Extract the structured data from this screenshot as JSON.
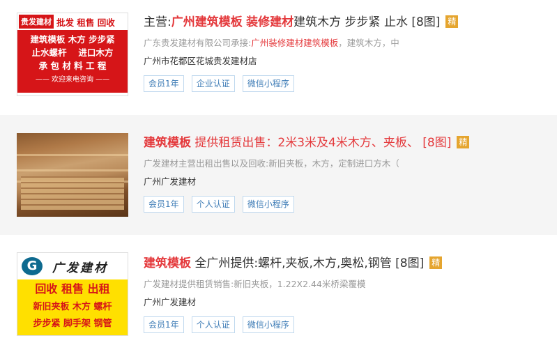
{
  "items": [
    {
      "title_prefix": "主营:",
      "title_kw1": "广州建筑模板",
      "title_sep": " ",
      "title_kw2": "装修建材",
      "title_rest": "建筑木方 步步紧 止水 [8图]",
      "badge": "精",
      "desc_prefix": "广东贵发建材有限公司承接:",
      "desc_red": "广州装修建材建筑模板",
      "desc_rest": "，建筑木方，中",
      "address": "广州市花都区花城贵发建材店",
      "tags": [
        "会员1年",
        "企业认证",
        "微信小程序"
      ],
      "thumb": {
        "logo": "贵发建材",
        "top_text": "批发 租售 回收",
        "lines": [
          "建筑模板 木方 步步紧",
          "止水螺杆　 进口木方",
          "承 包 材 料 工 程"
        ],
        "footer": "—— 欢迎来电咨询 ——"
      }
    },
    {
      "title_kw": "建筑模板",
      "title_rest": " 提供租赁出售：2米3米及4米木方、夹板、 [8图]",
      "badge": "精",
      "desc": "广发建材主营出租出售以及回收:新旧夹板，木方，定制进口方木（",
      "address": "广州广发建材",
      "tags": [
        "会员1年",
        "个人认证",
        "微信小程序"
      ]
    },
    {
      "title_kw": "建筑模板",
      "title_rest": " 全广州提供:螺杆,夹板,木方,奥松,钢管 [8图]",
      "badge": "精",
      "desc": "广发建材提供租赁销售:新旧夹板，1.22X2.44米桥梁覆模",
      "address": "广州广发建材",
      "tags": [
        "会员1年",
        "个人认证",
        "微信小程序"
      ],
      "thumb": {
        "logo_letter": "G",
        "brand": "广发建材",
        "line1": "回收 租售 出租",
        "line2": "新旧夹板 木方 螺杆",
        "line3": "步步紧 脚手架 钢管"
      }
    }
  ]
}
